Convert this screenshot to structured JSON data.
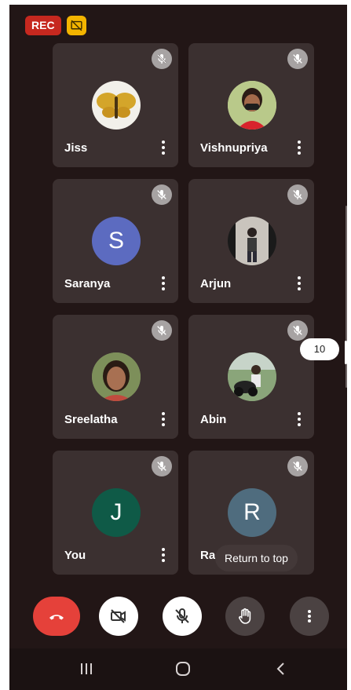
{
  "status": {
    "rec_label": "REC",
    "cast_icon": "screen-share-off-icon"
  },
  "participants": [
    {
      "name": "Jiss",
      "avatar_type": "photo",
      "muted": true
    },
    {
      "name": "Vishnupriya",
      "avatar_type": "photo",
      "muted": true
    },
    {
      "name": "Saranya",
      "avatar_type": "letter",
      "letter": "S",
      "avatar_color": "#5c6bc0",
      "muted": true
    },
    {
      "name": "Arjun",
      "avatar_type": "photo",
      "muted": true
    },
    {
      "name": "Sreelatha",
      "avatar_type": "photo",
      "muted": true
    },
    {
      "name": "Abin",
      "avatar_type": "photo",
      "muted": true
    },
    {
      "name": "You",
      "avatar_type": "letter",
      "letter": "J",
      "avatar_color": "#0f5a47",
      "muted": true
    },
    {
      "name": "Rad",
      "avatar_type": "letter",
      "letter": "R",
      "avatar_color": "#4f6c7e",
      "muted": true
    }
  ],
  "page_indicator": "10",
  "return_to_top_label": "Return to top",
  "controls": {
    "end_call_icon": "phone-hangup-icon",
    "camera_icon": "camera-off-icon",
    "mic_icon": "mic-off-icon",
    "hand_icon": "raise-hand-icon",
    "more_icon": "more-vertical-icon"
  },
  "colors": {
    "background": "#221616",
    "tile": "#3b3030",
    "end_call": "#e5413a",
    "rec": "#c6281f",
    "cast": "#f3b400"
  },
  "nav": {
    "recents": "recents-icon",
    "home": "home-icon",
    "back": "back-icon"
  }
}
